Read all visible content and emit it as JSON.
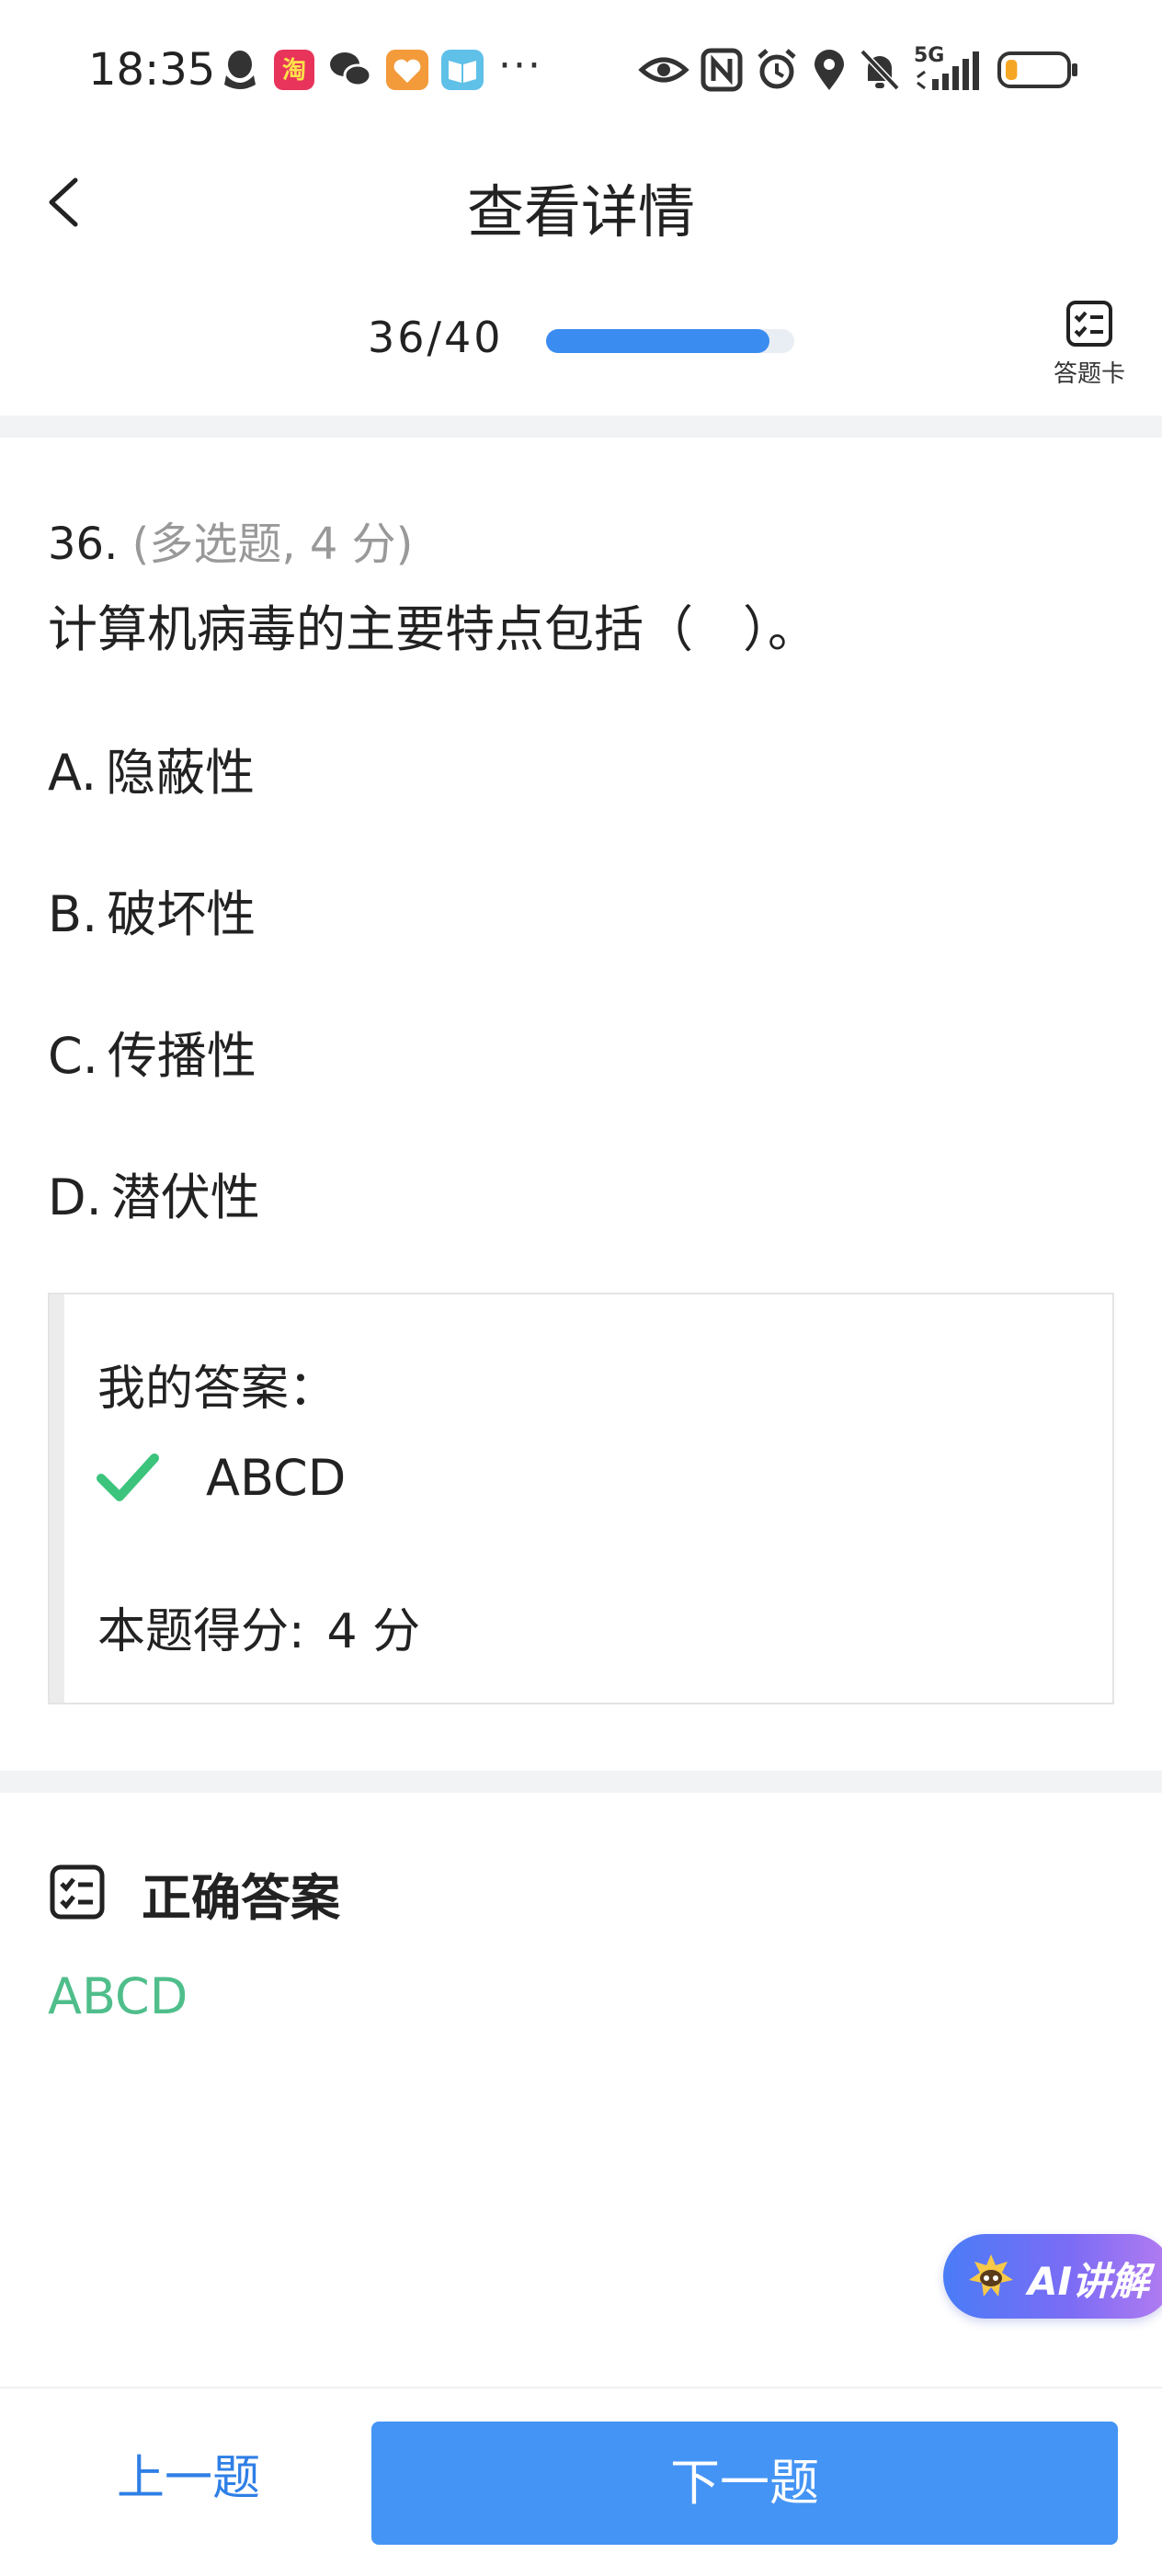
{
  "status_bar": {
    "time": "18:35",
    "more": "···",
    "network": "5G",
    "left_icons": [
      "qq-icon",
      "taobao-icon",
      "wechat-icon",
      "app-heart-icon",
      "reader-icon"
    ],
    "right_icons": [
      "eye-icon",
      "nfc-icon",
      "alarm-icon",
      "location-icon",
      "mute-icon",
      "signal-icon",
      "battery-icon"
    ],
    "battery_level": 0.2,
    "colors": {
      "battery": "#f5a623"
    }
  },
  "header": {
    "title": "查看详情"
  },
  "progress": {
    "text": "36/40",
    "current": 36,
    "total": 40,
    "card_label": "答题卡"
  },
  "question": {
    "number": "36.",
    "type": "(多选题, 4 分)",
    "text": "计算机病毒的主要特点包括（　）。",
    "options": [
      {
        "letter": "A.",
        "text": "隐蔽性"
      },
      {
        "letter": "B.",
        "text": "破坏性"
      },
      {
        "letter": "C.",
        "text": "传播性"
      },
      {
        "letter": "D.",
        "text": "潜伏性"
      }
    ]
  },
  "my_answer": {
    "label": "我的答案：",
    "value": "ABCD",
    "score_label": "本题得分:",
    "score_value": "4 分"
  },
  "correct_answer": {
    "title": "正确答案",
    "value": "ABCD"
  },
  "ai_button": {
    "label": "AI讲解"
  },
  "nav": {
    "prev": "上一题",
    "next": "下一题"
  },
  "colors": {
    "accent": "#4494f5",
    "correct": "#4fbe8b",
    "check": "#3cc47c"
  }
}
